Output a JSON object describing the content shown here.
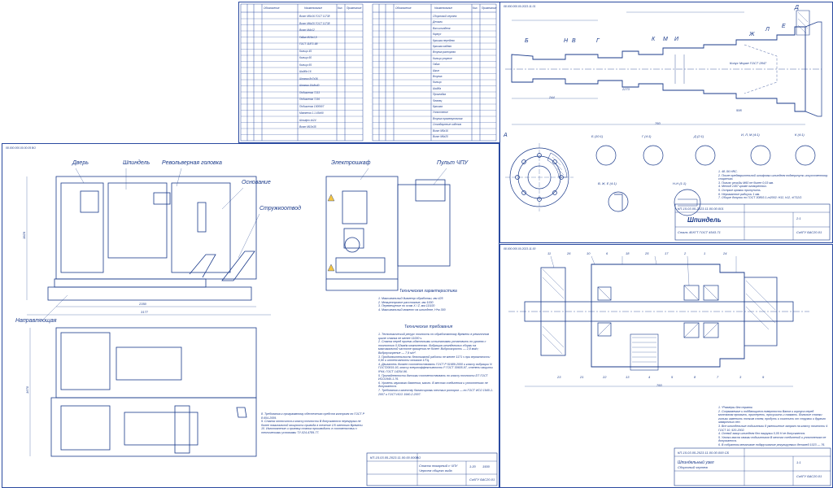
{
  "sheet_main": {
    "corner_code": "08.000.000.00.00.05 ВО",
    "labels": {
      "door": "Дверь",
      "spindle": "Шпиндель",
      "turret": "Револьверная головка",
      "base": "Основание",
      "chip_conveyor": "Стружкоотвод",
      "cabinet": "Электрошкаф",
      "cnc_panel": "Пульт ЧПУ",
      "guide": "Направляющая"
    },
    "dims": {
      "overall_length": "3177",
      "inner_length": "2350",
      "height": "1829",
      "width": "1670",
      "short_w": "1400"
    },
    "tech_header": "Техническая характеристика",
    "tech_items": [
      "1. Максимальный диаметр обработки, мм          425",
      "2. Межцентровое расстояние, мм                 1000",
      "3. Перемещение по осям X / Z, мм              115/20",
      "4. Максимальный момент на шпинделе, Н*м      300"
    ],
    "req_header": "Технические требования",
    "req_items": [
      "1. Технологический ресурс точности по обработанному Времени в ремонтном цикле станка не менее 11000 ч.",
      "2. Станок перед приемо-сдаточными испытаниями установить по уровню с точностью 0,02мм/м компонентах. Вибрация шпиндельных сборки на максимальной частоте вращения не более: Виброскорость — 2,8 мм/с; Виброускорение — 7,9 м/с².",
      "3. Продолжительность безотказной работы не менее 1171 ч при вероятности 0,90 и интенсивности отказов 1/ТЦ.",
      "4. Двигатель должен соответствовать ГОСТ Р 51689-2000 и классу вибрации N ГОСТ20815-93, классу энергоэффективности F ГОСТ 30605-97, степени защиты IP44; ГОСТ 14254-96.",
      "5. Принадлежности датчики соответствовать по классу точности DT ГОСТ ИСО1940-1-76.",
      "6. Уровень звукового давления, масло. В местах соединения и уплотнениях не допускается.",
      "7. Требования к качеству балансировки жестких роторов — по ГОСТ ИСО 1940-1-2007 и ГОСТ ИСО 1940-2-2007."
    ],
    "left_notes": [
      "8. Требования к программному обеспечению средств контроля по ГОСТ Р 8.654-2009.",
      "9. Станок относится к классу точности В допускаются перегрузки не более номинальной мощности привода в течение 1/5 сменного Времени.",
      "10. Изготовление и приемку станка производить в соответствии с техническими условиями ТУ-024-4789-77."
    ],
    "stamp": {
      "code": "КП-15.03.05-2023.11.00.00.000ВО",
      "title": "Станок токарный с ЧПУ",
      "subtitle": "Чертеж общего вида",
      "org": "СибГУ БАС20-01",
      "scale": "1:20",
      "mass": "1500"
    }
  },
  "sheet_spec": {
    "col_headers": [
      "Обозначение",
      "Наименование",
      "Кол.",
      "Примечание"
    ],
    "left_rows": [
      "Винт М5х16 ГОСТ 11738",
      "Винт М6х20 ГОСТ 11738",
      "Винт М4х12",
      "Гайка М16х1,5",
      "ГОСТ 11871-88",
      "Кольцо 45",
      "Кольцо 60",
      "Кольцо 65",
      "Шайба 16",
      "Шпонка 8х7х36",
      "Шпонка 10х8х40",
      "Подшипник 7213",
      "Подшипник 7216",
      "Подшипник 1000907",
      "Манжета 1.1-65х90",
      "Штифт 4х24",
      "Винт М10х35"
    ],
    "right_header": "Документация",
    "right_rows": [
      "Сборочный чертеж",
      "Детали",
      "Вал шпинделя",
      "Корпус",
      "Крышка передняя",
      "Крышка задняя",
      "Втулка распорная",
      "Кольцо упорное",
      "Гайка",
      "Шкив",
      "Втулка",
      "Кольцо",
      "Шайба",
      "Прокладка",
      "Фланец",
      "Крышка",
      "Уплотнение",
      "Втулка промежуточная",
      "Стандартные изделия",
      "Винт М5х16",
      "Винт М6х20"
    ]
  },
  "sheet_spindle": {
    "corner_code": "08.000.000.00.2023.11.01",
    "section_labels": [
      "Б",
      "Н",
      "В",
      "Г",
      "К",
      "М",
      "И",
      "Ж",
      "Л",
      "Е",
      "Д",
      "А"
    ],
    "details": [
      "А",
      "Б (10:1)",
      "Г (4:1)",
      "Д (2:1)",
      "И, Л, М (4:1)",
      "К (4:1)",
      "В, Ж, Е (4:1)",
      "Н-Н (1:1)"
    ],
    "dims": [
      "760",
      "244",
      "2273",
      "595",
      "156",
      "160",
      "2:1",
      "Ø60",
      "Ø65",
      "Ø70",
      "Конус Морзе ГОСТ 2847"
    ],
    "notes": [
      "1. 48..56 HRC.",
      "2. После предварительной шлифовки шпинделя подвергнуть искусственному старению.",
      "3. Полиэс резьбы М60 не более 0,03 мм.",
      "4. Метод 1457 кроме оговоренных.",
      "5. Острые кромки притупить.",
      "6. Неуказанные радиусы 1 мм.",
      "7. Общие допуски по ГОСТ 30893.1-m2002: Н12, h12, ±IT12/2."
    ],
    "stamp": {
      "code": "КП-15.03.05-2023.11.00.00.001",
      "title": "Шпиндель",
      "material": "Сталь 40ХГТ ГОСТ 4543-71",
      "org": "СибГУ БАС20-01",
      "scale": "2:1"
    }
  },
  "sheet_assembly": {
    "corner_code": "08.000.000.00.2023.11.00",
    "callouts": [
      "11",
      "26",
      "10",
      "6",
      "18",
      "25",
      "17",
      "2",
      "1",
      "24",
      "23",
      "21",
      "22",
      "13",
      "4",
      "5",
      "8",
      "7",
      "3",
      "9"
    ],
    "dim": "760",
    "notes": [
      "1. *Размеры для справок.",
      "2. Сопрягаемые и поддающиеся поверхности Валов и корпуса перед монтажом промыть, притереть, просушить и смазать. Вольные станки гильзы заменить тонким слоем, продуть и очистить от стружки и другого заварочных пен.",
      "3. Все шпиндельные подшипники 8 уменьшение затрат на классу точности 4 ГОСТ 10. 520-2002.",
      "4. Осевой зазор шпинделя без нагрузки 0,05 H не допускается.",
      "5. Уголки масла смазки подшипников В местах соединений и уплотнениях не допускается.",
      "6. В собранном механизме подкручивание регулируемых деталей 1023 — 76."
    ],
    "stamp": {
      "code": "КП-15.03.05-2023.11.00.00.000 СБ",
      "title": "Шпиндельный узел",
      "subtitle": "Сборочный чертеж",
      "org": "СибГУ БАС20-01",
      "scale": "1:1"
    }
  }
}
